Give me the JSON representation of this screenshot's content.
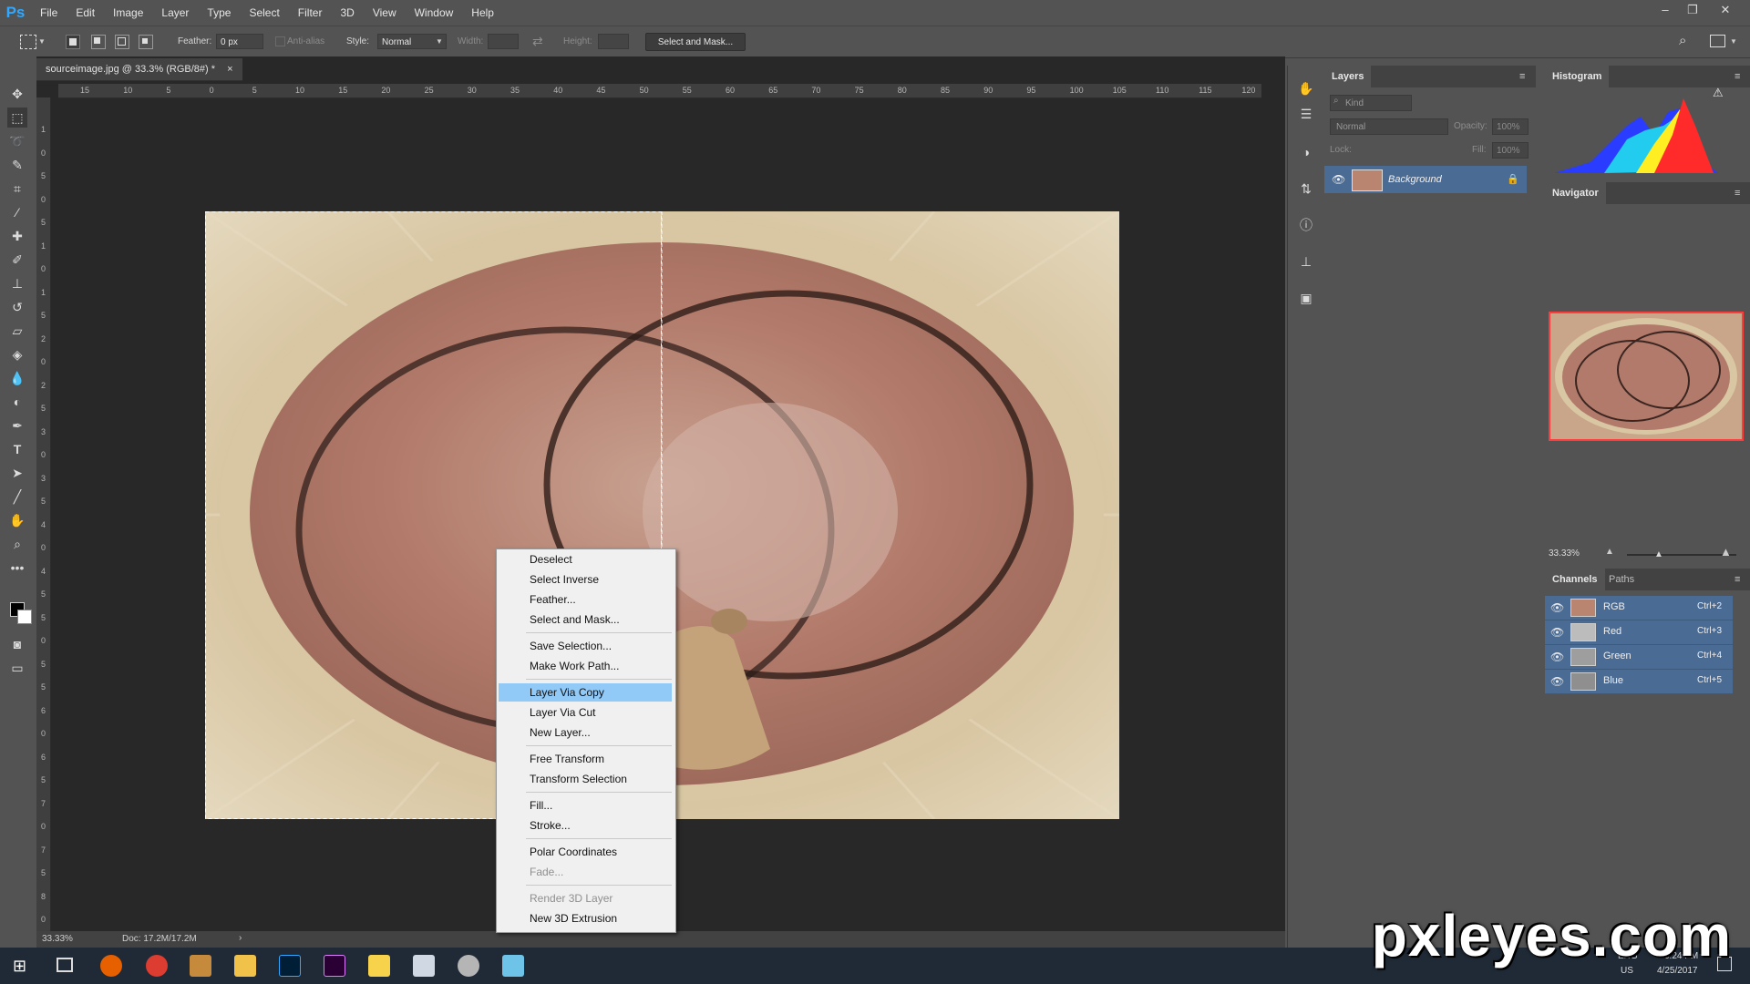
{
  "app": {
    "logo": "Ps"
  },
  "menu": [
    "File",
    "Edit",
    "Image",
    "Layer",
    "Type",
    "Select",
    "Filter",
    "3D",
    "View",
    "Window",
    "Help"
  ],
  "options": {
    "feather_label": "Feather:",
    "feather_value": "0 px",
    "antialias_label": "Anti-alias",
    "style_label": "Style:",
    "style_value": "Normal",
    "width_label": "Width:",
    "height_label": "Height:",
    "select_mask_button": "Select and Mask..."
  },
  "document": {
    "tab_title": "sourceimage.jpg @ 33.3% (RGB/8#) *",
    "tab_close": "×",
    "ruler_top": [
      "15",
      "10",
      "5",
      "0",
      "5",
      "10",
      "15",
      "20",
      "25",
      "30",
      "35",
      "40",
      "45",
      "50",
      "55",
      "60",
      "65",
      "70",
      "75",
      "80",
      "85",
      "90",
      "95",
      "100",
      "105",
      "110",
      "115",
      "120"
    ],
    "ruler_left": [
      "1",
      "0",
      "5",
      "0",
      "5",
      "1",
      "0",
      "1",
      "5",
      "2",
      "0",
      "2",
      "5",
      "3",
      "0",
      "3",
      "5",
      "4",
      "0",
      "4",
      "5",
      "5",
      "0",
      "5",
      "5",
      "6",
      "0",
      "6",
      "5",
      "7",
      "0",
      "7",
      "5",
      "8",
      "0"
    ]
  },
  "status": {
    "zoom": "33.33%",
    "doc": "Doc: 17.2M/17.2M",
    "arrow": "›"
  },
  "context_menu": {
    "items": [
      {
        "label": "Deselect",
        "state": "normal"
      },
      {
        "label": "Select Inverse",
        "state": "normal"
      },
      {
        "label": "Feather...",
        "state": "normal"
      },
      {
        "label": "Select and Mask...",
        "state": "normal"
      },
      {
        "label": "Save Selection...",
        "state": "normal"
      },
      {
        "label": "Make Work Path...",
        "state": "normal"
      },
      {
        "label": "Layer Via Copy",
        "state": "highlighted"
      },
      {
        "label": "Layer Via Cut",
        "state": "normal"
      },
      {
        "label": "New Layer...",
        "state": "normal"
      },
      {
        "label": "Free Transform",
        "state": "normal"
      },
      {
        "label": "Transform Selection",
        "state": "normal"
      },
      {
        "label": "Fill...",
        "state": "normal"
      },
      {
        "label": "Stroke...",
        "state": "normal"
      },
      {
        "label": "Polar Coordinates",
        "state": "normal"
      },
      {
        "label": "Fade...",
        "state": "disabled"
      },
      {
        "label": "Render 3D Layer",
        "state": "disabled"
      },
      {
        "label": "New 3D Extrusion",
        "state": "normal"
      }
    ]
  },
  "layers": {
    "tab": "Layers",
    "kind": "Kind",
    "blend": "Normal",
    "opacity_label": "Opacity:",
    "opacity_value": "100%",
    "lock_label": "Lock:",
    "fill_label": "Fill:",
    "fill_value": "100%",
    "layer_name": "Background"
  },
  "histogram": {
    "tab": "Histogram"
  },
  "navigator": {
    "tab": "Navigator",
    "zoom": "33.33%"
  },
  "channels": {
    "tabs": [
      "Channels",
      "Paths"
    ],
    "rows": [
      {
        "name": "RGB",
        "key": "Ctrl+2"
      },
      {
        "name": "Red",
        "key": "Ctrl+3"
      },
      {
        "name": "Green",
        "key": "Ctrl+4"
      },
      {
        "name": "Blue",
        "key": "Ctrl+5"
      }
    ]
  },
  "taskbar": {
    "lang1": "ENG",
    "lang2": "US",
    "time": "6:24 PM",
    "date": "4/25/2017"
  },
  "watermark": "pxleyes.com",
  "colors": {
    "accent": "#31a8ff",
    "menu_highlight": "#91c9f7",
    "channel_selected": "#4a6b94",
    "navigator_box": "#ff3b3b"
  }
}
